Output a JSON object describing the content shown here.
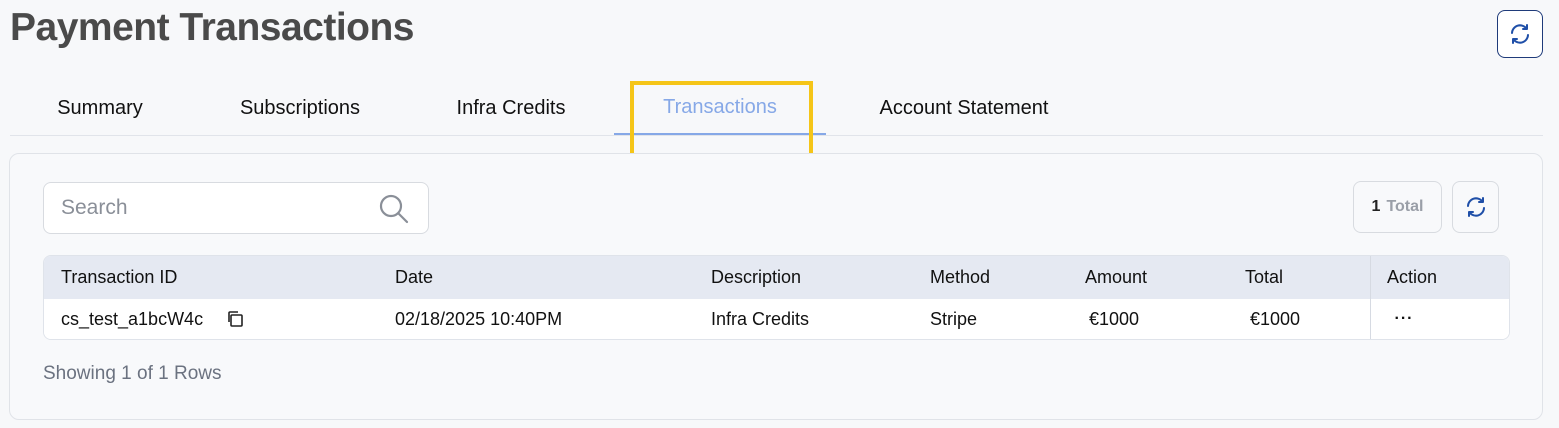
{
  "page": {
    "title": "Payment Transactions"
  },
  "tabs": [
    {
      "label": "Summary"
    },
    {
      "label": "Subscriptions"
    },
    {
      "label": "Infra Credits"
    },
    {
      "label": "Transactions",
      "active": true
    },
    {
      "label": "Account Statement"
    }
  ],
  "search": {
    "placeholder": "Search",
    "value": ""
  },
  "total": {
    "count": "1",
    "label": "Total"
  },
  "table": {
    "columns": [
      "Transaction ID",
      "Date",
      "Description",
      "Method",
      "Amount",
      "Total",
      "Action"
    ],
    "rows": [
      {
        "transaction_id": "cs_test_a1bcW4c",
        "date": "02/18/2025 10:40PM",
        "description": "Infra Credits",
        "method": "Stripe",
        "amount": "€1000",
        "total": "€1000",
        "action": "···"
      }
    ]
  },
  "footer": {
    "status": "Showing 1 of 1 Rows"
  },
  "colors": {
    "accent": "#86a8e7",
    "highlight": "#f5c518",
    "title": "#4a4a4a",
    "icon_blue": "#1f4fa8"
  }
}
